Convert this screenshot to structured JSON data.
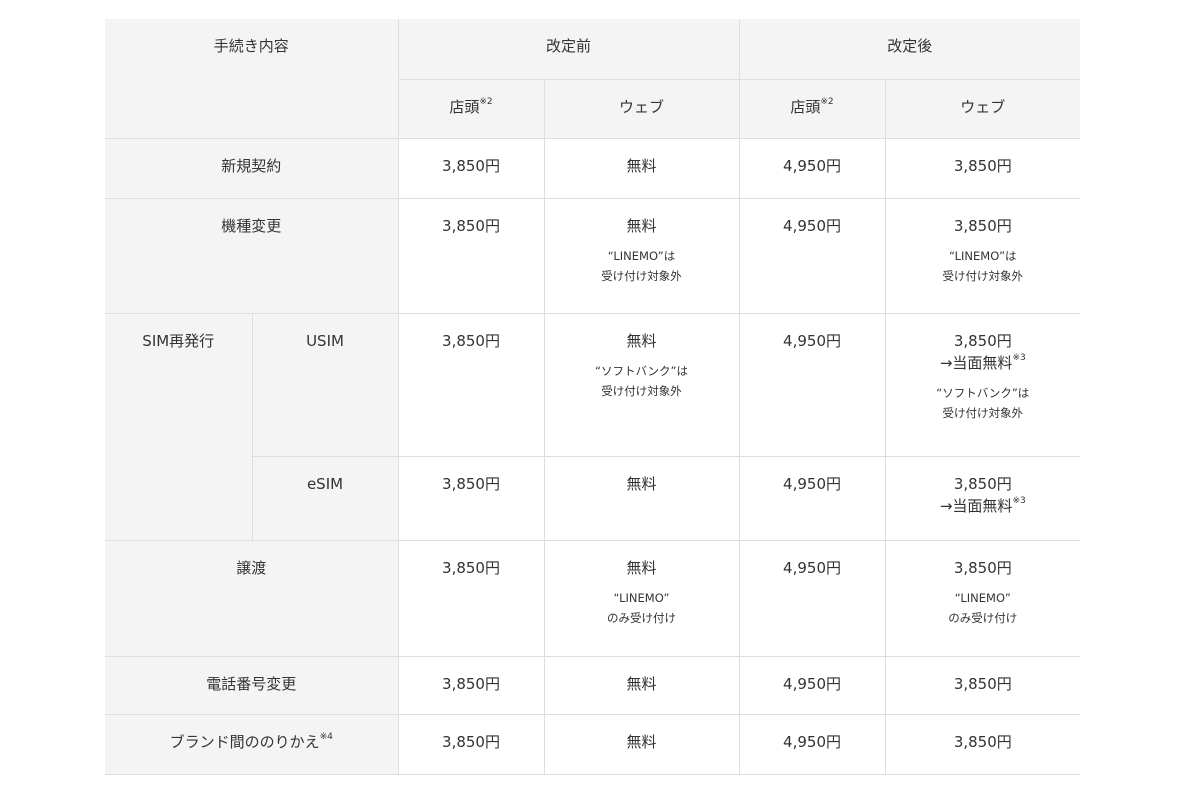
{
  "header": {
    "procedure": "手続き内容",
    "before": "改定前",
    "after": "改定後",
    "store": "店頭",
    "store_sup": "※2",
    "web": "ウェブ"
  },
  "rows": {
    "new": {
      "label": "新規契約",
      "b_store": "3,850円",
      "b_web": "無料",
      "a_store": "4,950円",
      "a_web": "3,850円"
    },
    "change": {
      "label": "機種変更",
      "b_store": "3,850円",
      "b_web": "無料",
      "b_web_note1": "“LINEMO”は",
      "b_web_note2": "受け付け対象外",
      "a_store": "4,950円",
      "a_web": "3,850円",
      "a_web_note1": "“LINEMO”は",
      "a_web_note2": "受け付け対象外"
    },
    "sim": {
      "label": "SIM再発行"
    },
    "usim": {
      "label": "USIM",
      "b_store": "3,850円",
      "b_web": "無料",
      "b_web_note1": "“ソフトバンク”は",
      "b_web_note2": "受け付け対象外",
      "a_store": "4,950円",
      "a_web": "3,850円",
      "a_web_free": "→当面無料",
      "a_web_sup": "※3",
      "a_web_note1": "“ソフトバンク”は",
      "a_web_note2": "受け付け対象外"
    },
    "esim": {
      "label": "eSIM",
      "b_store": "3,850円",
      "b_web": "無料",
      "a_store": "4,950円",
      "a_web": "3,850円",
      "a_web_free": "→当面無料",
      "a_web_sup": "※3"
    },
    "transfer": {
      "label": "譲渡",
      "b_store": "3,850円",
      "b_web": "無料",
      "b_web_note1": "“LINEMO”",
      "b_web_note2": "のみ受け付け",
      "a_store": "4,950円",
      "a_web": "3,850円",
      "a_web_note1": "“LINEMO”",
      "a_web_note2": "のみ受け付け"
    },
    "phone": {
      "label": "電話番号変更",
      "b_store": "3,850円",
      "b_web": "無料",
      "a_store": "4,950円",
      "a_web": "3,850円"
    },
    "brand": {
      "label": "ブランド間ののりかえ",
      "label_sup": "※4",
      "b_store": "3,850円",
      "b_web": "無料",
      "a_store": "4,950円",
      "a_web": "3,850円"
    }
  }
}
